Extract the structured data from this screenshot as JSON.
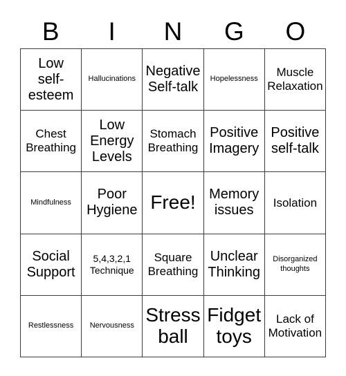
{
  "card": {
    "title_letters": [
      "B",
      "I",
      "N",
      "G",
      "O"
    ],
    "columns": 5,
    "rows": 5,
    "border_color": "#3b3b3b",
    "background_color": "#ffffff",
    "text_color": "#000000",
    "free_space": "Free!",
    "cells": [
      {
        "r": 1,
        "c": 1,
        "text": "Low\nself-\nesteem",
        "size": "lg"
      },
      {
        "r": 1,
        "c": 2,
        "text": "Hallucinations",
        "size": "xs"
      },
      {
        "r": 1,
        "c": 3,
        "text": "Negative\nSelf-talk",
        "size": "lg"
      },
      {
        "r": 1,
        "c": 4,
        "text": "Hopelessness",
        "size": "xs"
      },
      {
        "r": 1,
        "c": 5,
        "text": "Muscle\nRelaxation",
        "size": "md"
      },
      {
        "r": 2,
        "c": 1,
        "text": "Chest\nBreathing",
        "size": "md"
      },
      {
        "r": 2,
        "c": 2,
        "text": "Low\nEnergy\nLevels",
        "size": "lg"
      },
      {
        "r": 2,
        "c": 3,
        "text": "Stomach\nBreathing",
        "size": "md"
      },
      {
        "r": 2,
        "c": 4,
        "text": "Positive\nImagery",
        "size": "lg"
      },
      {
        "r": 2,
        "c": 5,
        "text": "Positive\nself-talk",
        "size": "lg"
      },
      {
        "r": 3,
        "c": 1,
        "text": "Mindfulness",
        "size": "xs"
      },
      {
        "r": 3,
        "c": 2,
        "text": "Poor\nHygiene",
        "size": "lg"
      },
      {
        "r": 3,
        "c": 3,
        "text": "Free!",
        "size": "xxl"
      },
      {
        "r": 3,
        "c": 4,
        "text": "Memory\nissues",
        "size": "lg"
      },
      {
        "r": 3,
        "c": 5,
        "text": "Isolation",
        "size": "md"
      },
      {
        "r": 4,
        "c": 1,
        "text": "Social\nSupport",
        "size": "lg"
      },
      {
        "r": 4,
        "c": 2,
        "text": "5,4,3,2,1\nTechnique",
        "size": "sm"
      },
      {
        "r": 4,
        "c": 3,
        "text": "Square\nBreathing",
        "size": "md"
      },
      {
        "r": 4,
        "c": 4,
        "text": "Unclear\nThinking",
        "size": "lg"
      },
      {
        "r": 4,
        "c": 5,
        "text": "Disorganized\nthoughts",
        "size": "xs"
      },
      {
        "r": 5,
        "c": 1,
        "text": "Restlessness",
        "size": "xs"
      },
      {
        "r": 5,
        "c": 2,
        "text": "Nervousness",
        "size": "xs"
      },
      {
        "r": 5,
        "c": 3,
        "text": "Stress\nball",
        "size": "xxl"
      },
      {
        "r": 5,
        "c": 4,
        "text": "Fidget\ntoys",
        "size": "xxl"
      },
      {
        "r": 5,
        "c": 5,
        "text": "Lack of\nMotivation",
        "size": "md"
      }
    ]
  }
}
